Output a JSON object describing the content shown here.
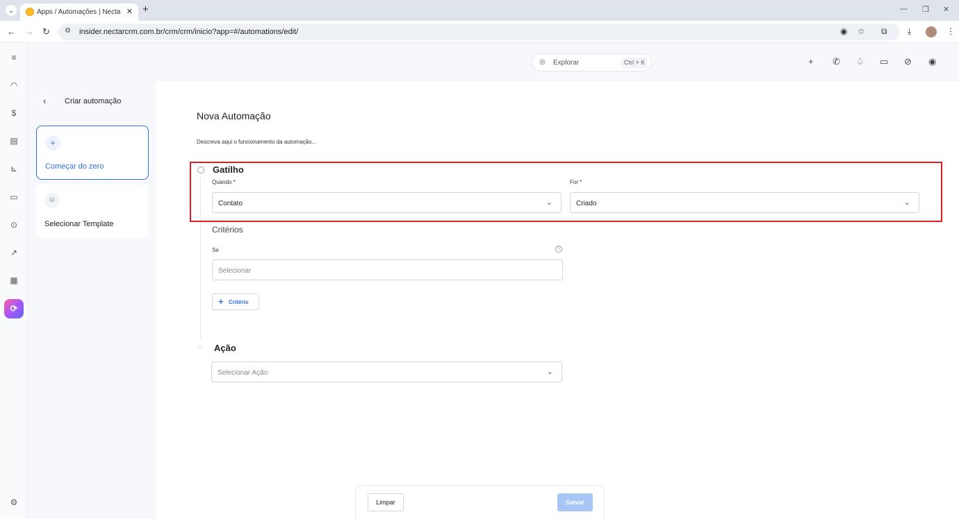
{
  "browser": {
    "tab_title": "Apps / Automações | NectarCRM",
    "url": "insider.nectarcrm.com.br/crm/crm/inicio?app=#/automations/edit/"
  },
  "header": {
    "search_label": "Explorar",
    "search_shortcut": "Ctrl + K"
  },
  "left_panel": {
    "title": "Criar automação",
    "cards": [
      {
        "label": "Começar do zero",
        "icon": "plus-icon"
      },
      {
        "label": "Selecionar Template",
        "icon": "template-icon"
      }
    ]
  },
  "main": {
    "title": "Nova Automação",
    "description": "Descreva aqui o funcionamento da automação...",
    "trigger": {
      "title": "Gatilho",
      "when_label": "Quando *",
      "when_value": "Contato",
      "for_label": "For *",
      "for_value": "Criado"
    },
    "criteria": {
      "title": "Critérios",
      "if_label": "Se",
      "placeholder": "Selecionar",
      "add_label": "Critério"
    },
    "action": {
      "title": "Ação",
      "placeholder": "Selecionar Ação"
    }
  },
  "footer": {
    "clear_label": "Limpar",
    "save_label": "Salvar"
  },
  "colors": {
    "accent": "#2f6fe0",
    "highlight": "#e02020",
    "save_disabled": "#a7c5f5"
  }
}
